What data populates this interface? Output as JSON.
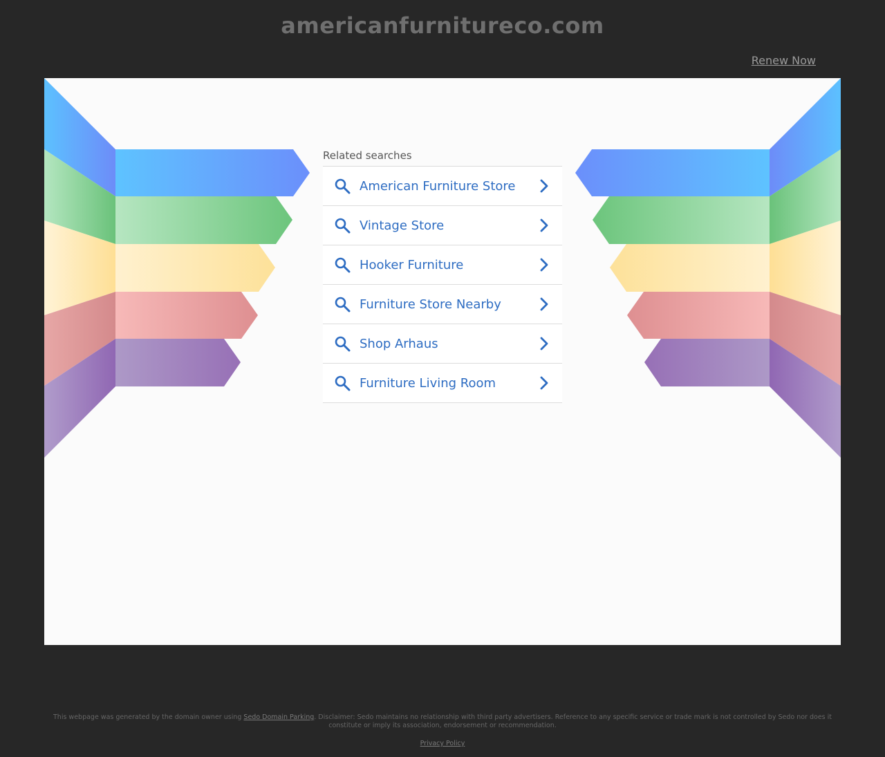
{
  "header": {
    "domain": "americanfurnitureco.com",
    "renew_label": "Renew Now"
  },
  "related": {
    "heading": "Related searches",
    "items": [
      {
        "label": "American Furniture Store"
      },
      {
        "label": "Vintage Store"
      },
      {
        "label": "Hooker Furniture"
      },
      {
        "label": "Furniture Store Nearby"
      },
      {
        "label": "Shop Arhaus"
      },
      {
        "label": "Furniture Living Room"
      }
    ]
  },
  "footer": {
    "prefix": "This webpage was generated by the domain owner using ",
    "sedo_link": "Sedo Domain Parking",
    "disclaimer": ". Disclaimer: Sedo maintains no relationship with third party advertisers. Reference to any specific service or trade mark is not controlled by Sedo nor does it constitute or imply its association, endorsement or recommendation.",
    "privacy": "Privacy Policy"
  },
  "colors": {
    "background": "#272727",
    "panel": "#fbfbfb",
    "link": "#2d6cc2",
    "stripe_blue": "#62bdfd",
    "stripe_green": "#6ec67f",
    "stripe_yellow": "#fde59a",
    "stripe_pink": "#f4b5b5",
    "stripe_purple": "#9b79b9"
  },
  "icons": [
    "search-icon",
    "chevron-right-icon"
  ]
}
